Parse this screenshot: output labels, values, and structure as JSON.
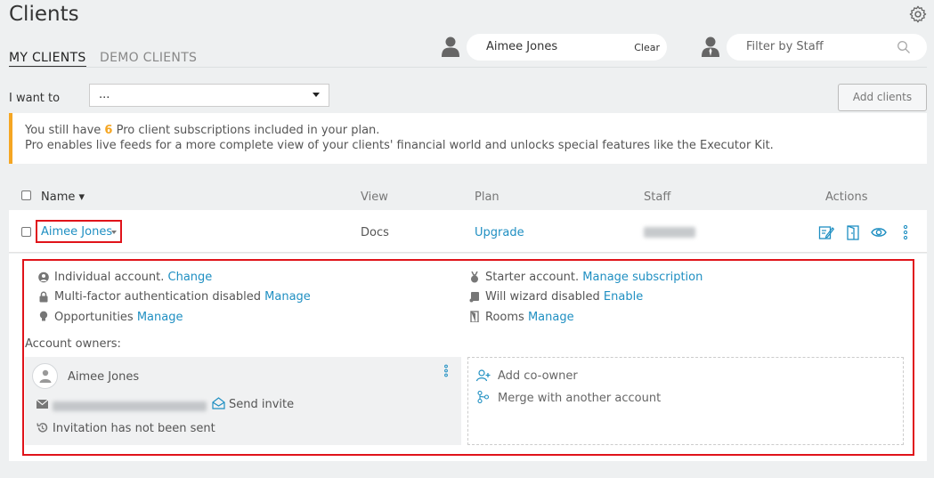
{
  "page_title": "Clients",
  "tabs": [
    {
      "label": "MY CLIENTS",
      "active": true
    },
    {
      "label": "DEMO CLIENTS",
      "active": false
    }
  ],
  "client_filter": {
    "value": "Aimee Jones",
    "clear_label": "Clear"
  },
  "staff_filter": {
    "placeholder": "Filter by Staff"
  },
  "i_want_to": {
    "label": "I want to",
    "selected": "..."
  },
  "add_clients_label": "Add clients",
  "notice": {
    "line1_prefix": "You still have ",
    "count": "6",
    "line1_suffix": " Pro client subscriptions included in your plan.",
    "line2": "Pro enables live feeds for a more complete view of your clients' financial world and unlocks special features like the Executor Kit."
  },
  "table": {
    "headers": {
      "name": "Name ▾",
      "view": "View",
      "plan": "Plan",
      "staff": "Staff",
      "actions": "Actions"
    },
    "row": {
      "name": "Aimee Jones",
      "view": "Docs",
      "plan": "Upgrade"
    }
  },
  "details": {
    "left": [
      {
        "icon": "user-circle-icon",
        "text": "Individual account. ",
        "link": "Change"
      },
      {
        "icon": "lock-icon",
        "text": "Multi-factor authentication disabled ",
        "link": "Manage"
      },
      {
        "icon": "lightbulb-icon",
        "text": "Opportunities ",
        "link": "Manage"
      }
    ],
    "right": [
      {
        "icon": "medal-icon",
        "text": "Starter account. ",
        "link": "Manage subscription"
      },
      {
        "icon": "scroll-icon",
        "text": "Will wizard disabled ",
        "link": "Enable"
      },
      {
        "icon": "rooms-icon",
        "text": "Rooms ",
        "link": "Manage"
      }
    ],
    "owners_label": "Account owners:",
    "owner_name": "Aimee Jones",
    "send_invite": "Send invite",
    "invitation_status": "Invitation has not been sent",
    "add_coowner": "Add co-owner",
    "merge": "Merge with another account"
  },
  "colors": {
    "accent": "#1f8fc2",
    "warning": "#f5a623",
    "highlight": "#e0131a"
  }
}
